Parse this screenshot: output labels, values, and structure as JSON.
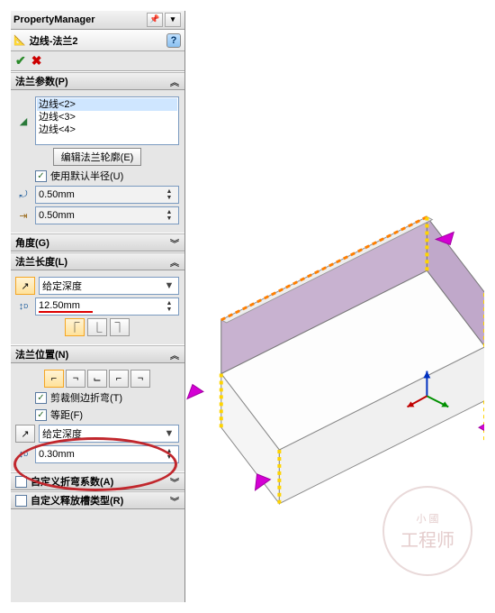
{
  "pm": {
    "title": "PropertyManager"
  },
  "feature": {
    "icon": "edge-flange-icon",
    "name": "边线-法兰2"
  },
  "confirm": {
    "ok": "✔",
    "cancel": "✖"
  },
  "sections": {
    "params": {
      "title": "法兰参数(P)",
      "edges": [
        "边线<2>",
        "边线<3>",
        "边线<4>"
      ],
      "editProfile": "编辑法兰轮廓(E)",
      "useDefaultRadius": {
        "label": "使用默认半径(U)",
        "checked": true
      },
      "radius1": "0.50mm",
      "radius2": "0.50mm"
    },
    "angle": {
      "title": "角度(G)"
    },
    "length": {
      "title": "法兰长度(L)",
      "condition": "给定深度",
      "value": "12.50mm"
    },
    "position": {
      "title": "法兰位置(N)",
      "trimSideBends": {
        "label": "剪裁侧边折弯(T)",
        "checked": true
      },
      "equalOffset": {
        "label": "等距(F)",
        "checked": true
      },
      "condition": "给定深度",
      "value": "0.30mm"
    },
    "bendAllow": {
      "title": "自定义折弯系数(A)",
      "checked": false
    },
    "relief": {
      "title": "自定义释放槽类型(R)",
      "checked": false
    }
  },
  "watermark": {
    "line1": "小 國",
    "line2": "工程师"
  }
}
